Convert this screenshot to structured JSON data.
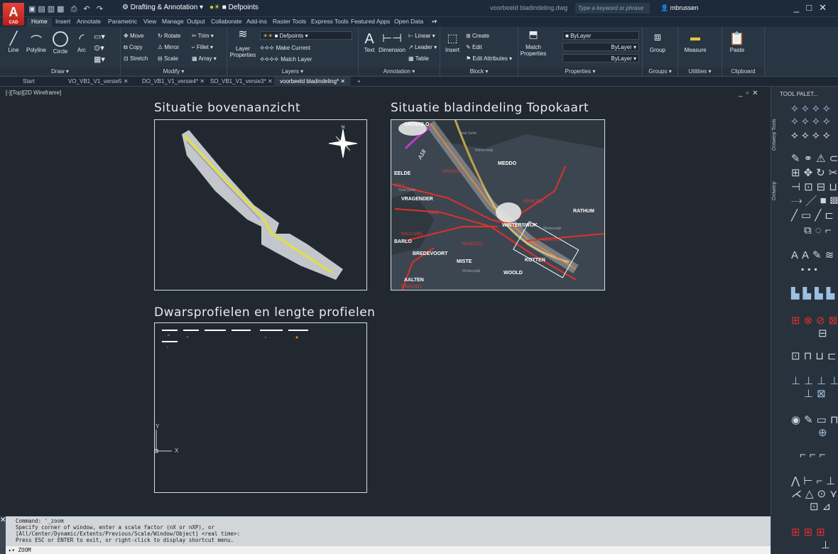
{
  "app": {
    "logo": "A",
    "logo_sub": "CAD"
  },
  "quickaccess": {
    "workspace": "Drafting & Annotation",
    "layer": "Defpoints",
    "file": "voorbeeld bladindeling.dwg",
    "search_placeholder": "Type a keyword or phrase",
    "user": "mbrussen"
  },
  "ribbon_tabs": [
    "Home",
    "Insert",
    "Annotate",
    "Parametric",
    "View",
    "Manage",
    "Output",
    "Collaborate",
    "Add-ins",
    "Raster Tools",
    "Express Tools",
    "Featured Apps",
    "Open Data"
  ],
  "ribbon": {
    "draw": {
      "label": "Draw",
      "items": [
        "Line",
        "Polyline",
        "Circle",
        "Arc"
      ]
    },
    "modify": {
      "label": "Modify",
      "items": [
        "Move",
        "Rotate",
        "Trim",
        "Copy",
        "Mirror",
        "Fillet",
        "Stretch",
        "Scale",
        "Array"
      ]
    },
    "layers": {
      "label": "Layers",
      "layer_props": "Layer Properties",
      "layer_combo": "Defpoints",
      "make_current": "Make Current",
      "match_layer": "Match Layer"
    },
    "annotation": {
      "label": "Annotation",
      "text": "Text",
      "dimension": "Dimension",
      "linear": "Linear",
      "leader": "Leader",
      "table": "Table"
    },
    "block": {
      "label": "Block",
      "insert": "Insert",
      "create": "Create",
      "edit": "Edit",
      "edit_attributes": "Edit Attributes"
    },
    "properties": {
      "label": "Properties",
      "match": "Match Properties",
      "bylayer1": "ByLayer",
      "bylayer2": "ByLayer",
      "bylayer3": "ByLayer"
    },
    "groups": {
      "label": "Groups",
      "group": "Group"
    },
    "utilities": {
      "label": "Utilities",
      "measure": "Measure"
    },
    "clipboard": {
      "label": "Clipboard",
      "paste": "Paste"
    }
  },
  "doc_tabs": [
    "Start",
    "VO_VB1_V1_versie5",
    "DO_VB1_V1_versie4*",
    "SO_VB1_V1_versie3*",
    "voorbeeld bladindeling*"
  ],
  "viewport": {
    "label": "[-][Top][2D Wireframe]"
  },
  "drawing": {
    "title1": "Situatie bovenaanzicht",
    "title2": "Situatie bladindeling Topokaart",
    "title3": "Dwarsprofielen en lengte profielen",
    "ucs_y": "Y",
    "ucs_x": "X",
    "compass_n": "N"
  },
  "map_labels": {
    "towns": [
      "GROENLO",
      "MEDDO",
      "EELDE",
      "VRAGENDER",
      "RATHUM",
      "WINTERSWIJK",
      "BARLO",
      "BREDEVOORT",
      "MISTE",
      "KOTTEN",
      "WOOLD",
      "AALTEN"
    ],
    "roads": [
      "N319(191)",
      "N313",
      "N319(191)",
      "N313",
      "N313 (185)",
      "N318(137)",
      "N319(137)",
      "N318(145)",
      "A18"
    ],
    "small": [
      "Oost Gelre",
      "Winterswijk",
      "Oost Gelre",
      "Winterswijk",
      "Winterswijk"
    ]
  },
  "tool_palette": {
    "title": "TOOL PALET...",
    "tab1": "Ontwerp Tools",
    "tab2": "Ontwerp"
  },
  "command": {
    "history": "Command: '_zoom\nSpecify corner of window, enter a scale factor (nX or nXP), or\n[All/Center/Dynamic/Extents/Previous/Scale/Window/Object] <real time>:\nPress ESC or ENTER to exit, or right-click to display shortcut menu.",
    "prompt": "ZOOM"
  }
}
